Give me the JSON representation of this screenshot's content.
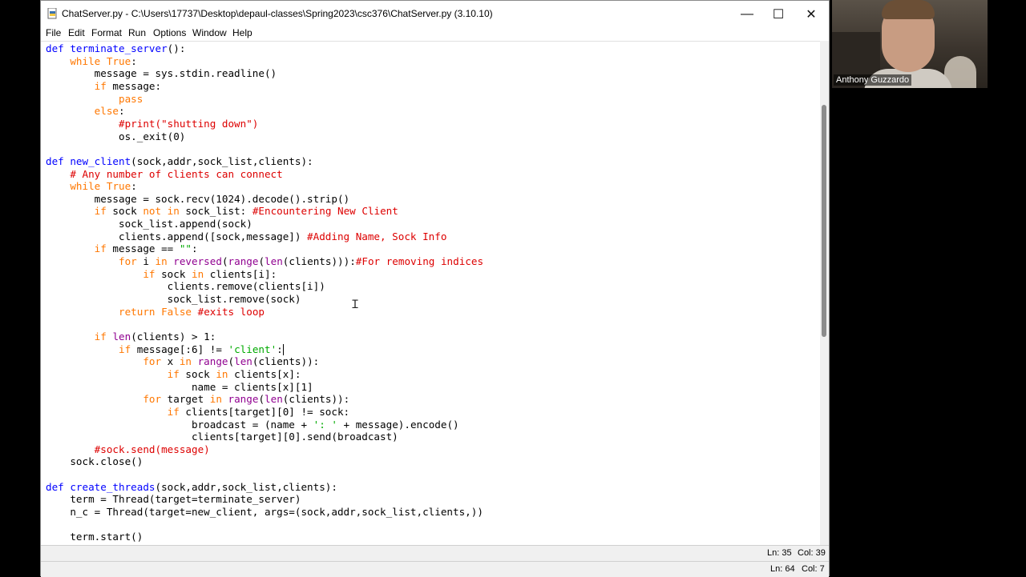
{
  "window": {
    "title": "ChatServer.py - C:\\Users\\17737\\Desktop\\depaul-classes\\Spring2023\\csc376\\ChatServer.py (3.10.10)",
    "controls": {
      "minimize": "—",
      "maximize": "☐",
      "close": "✕"
    }
  },
  "menu": [
    "File",
    "Edit",
    "Format",
    "Run",
    "Options",
    "Window",
    "Help"
  ],
  "editor": {
    "lines": [
      [
        [
          "def",
          "def"
        ],
        [
          "t",
          " "
        ],
        [
          "def",
          "terminate_server"
        ],
        [
          "t",
          "():"
        ]
      ],
      [
        [
          "t",
          "    "
        ],
        [
          "kw",
          "while"
        ],
        [
          "t",
          " "
        ],
        [
          "kw",
          "True"
        ],
        [
          "t",
          ":"
        ]
      ],
      [
        [
          "t",
          "        message = sys.stdin.readline()"
        ]
      ],
      [
        [
          "t",
          "        "
        ],
        [
          "kw",
          "if"
        ],
        [
          "t",
          " message:"
        ]
      ],
      [
        [
          "t",
          "            "
        ],
        [
          "kw",
          "pass"
        ]
      ],
      [
        [
          "t",
          "        "
        ],
        [
          "kw",
          "else"
        ],
        [
          "t",
          ":"
        ]
      ],
      [
        [
          "t",
          "            "
        ],
        [
          "cm",
          "#print(\"shutting down\")"
        ]
      ],
      [
        [
          "t",
          "            os._exit(0)"
        ]
      ],
      [
        [
          "t",
          ""
        ]
      ],
      [
        [
          "def",
          "def"
        ],
        [
          "t",
          " "
        ],
        [
          "def",
          "new_client"
        ],
        [
          "t",
          "(sock,addr,sock_list,clients):"
        ]
      ],
      [
        [
          "t",
          "    "
        ],
        [
          "cm",
          "# Any number of clients can connect"
        ]
      ],
      [
        [
          "t",
          "    "
        ],
        [
          "kw",
          "while"
        ],
        [
          "t",
          " "
        ],
        [
          "kw",
          "True"
        ],
        [
          "t",
          ":"
        ]
      ],
      [
        [
          "t",
          "        message = sock.recv(1024).decode().strip()"
        ]
      ],
      [
        [
          "t",
          "        "
        ],
        [
          "kw",
          "if"
        ],
        [
          "t",
          " sock "
        ],
        [
          "kw",
          "not in"
        ],
        [
          "t",
          " sock_list: "
        ],
        [
          "cm",
          "#Encountering New Client"
        ]
      ],
      [
        [
          "t",
          "            sock_list.append(sock)"
        ]
      ],
      [
        [
          "t",
          "            clients.append([sock,message]) "
        ],
        [
          "cm",
          "#Adding Name, Sock Info"
        ]
      ],
      [
        [
          "t",
          "        "
        ],
        [
          "kw",
          "if"
        ],
        [
          "t",
          " message == "
        ],
        [
          "str",
          "\"\""
        ],
        [
          "t",
          ":"
        ]
      ],
      [
        [
          "t",
          "            "
        ],
        [
          "kw",
          "for"
        ],
        [
          "t",
          " i "
        ],
        [
          "kw",
          "in"
        ],
        [
          "t",
          " "
        ],
        [
          "bi",
          "reversed"
        ],
        [
          "t",
          "("
        ],
        [
          "bi",
          "range"
        ],
        [
          "t",
          "("
        ],
        [
          "bi",
          "len"
        ],
        [
          "t",
          "(clients))):"
        ],
        [
          "cm",
          "#For removing indices"
        ]
      ],
      [
        [
          "t",
          "                "
        ],
        [
          "kw",
          "if"
        ],
        [
          "t",
          " sock "
        ],
        [
          "kw",
          "in"
        ],
        [
          "t",
          " clients[i]:"
        ]
      ],
      [
        [
          "t",
          "                    clients.remove(clients[i])"
        ]
      ],
      [
        [
          "t",
          "                    sock_list.remove(sock)"
        ]
      ],
      [
        [
          "t",
          "            "
        ],
        [
          "kw",
          "return"
        ],
        [
          "t",
          " "
        ],
        [
          "kw",
          "False"
        ],
        [
          "t",
          " "
        ],
        [
          "cm",
          "#exits loop"
        ]
      ],
      [
        [
          "t",
          ""
        ]
      ],
      [
        [
          "t",
          "        "
        ],
        [
          "kw",
          "if"
        ],
        [
          "t",
          " "
        ],
        [
          "bi",
          "len"
        ],
        [
          "t",
          "(clients) > 1:"
        ]
      ],
      [
        [
          "t",
          "            "
        ],
        [
          "kw",
          "if"
        ],
        [
          "t",
          " message[:6] != "
        ],
        [
          "str",
          "'client'"
        ],
        [
          "t",
          ":"
        ],
        [
          "caret",
          ""
        ]
      ],
      [
        [
          "t",
          "                "
        ],
        [
          "kw",
          "for"
        ],
        [
          "t",
          " x "
        ],
        [
          "kw",
          "in"
        ],
        [
          "t",
          " "
        ],
        [
          "bi",
          "range"
        ],
        [
          "t",
          "("
        ],
        [
          "bi",
          "len"
        ],
        [
          "t",
          "(clients)):"
        ]
      ],
      [
        [
          "t",
          "                    "
        ],
        [
          "kw",
          "if"
        ],
        [
          "t",
          " sock "
        ],
        [
          "kw",
          "in"
        ],
        [
          "t",
          " clients[x]:"
        ]
      ],
      [
        [
          "t",
          "                        name = clients[x][1]"
        ]
      ],
      [
        [
          "t",
          "                "
        ],
        [
          "kw",
          "for"
        ],
        [
          "t",
          " target "
        ],
        [
          "kw",
          "in"
        ],
        [
          "t",
          " "
        ],
        [
          "bi",
          "range"
        ],
        [
          "t",
          "("
        ],
        [
          "bi",
          "len"
        ],
        [
          "t",
          "(clients)):"
        ]
      ],
      [
        [
          "t",
          "                    "
        ],
        [
          "kw",
          "if"
        ],
        [
          "t",
          " clients[target][0] != sock:"
        ]
      ],
      [
        [
          "t",
          "                        broadcast = (name + "
        ],
        [
          "str",
          "': '"
        ],
        [
          "t",
          " + message).encode()"
        ]
      ],
      [
        [
          "t",
          "                        clients[target][0].send(broadcast)"
        ]
      ],
      [
        [
          "t",
          "        "
        ],
        [
          "cm",
          "#sock.send(message)"
        ]
      ],
      [
        [
          "t",
          "    sock.close()"
        ]
      ],
      [
        [
          "t",
          ""
        ]
      ],
      [
        [
          "def",
          "def"
        ],
        [
          "t",
          " "
        ],
        [
          "def",
          "create_threads"
        ],
        [
          "t",
          "(sock,addr,sock_list,clients):"
        ]
      ],
      [
        [
          "t",
          "    term = Thread(target=terminate_server)"
        ]
      ],
      [
        [
          "t",
          "    n_c = Thread(target=new_client, args=(sock,addr,sock_list,clients,))"
        ]
      ],
      [
        [
          "t",
          ""
        ]
      ],
      [
        [
          "t",
          "    term.start()"
        ]
      ]
    ]
  },
  "status": {
    "primary": {
      "line": "Ln: 35",
      "col": "Col: 39"
    },
    "secondary": {
      "line": "Ln: 64",
      "col": "Col: 7"
    }
  },
  "webcam": {
    "name": "Anthony Guzzardo"
  },
  "icons": {
    "window_icon": "python-file-icon",
    "cursor": "i-beam-cursor-icon"
  }
}
